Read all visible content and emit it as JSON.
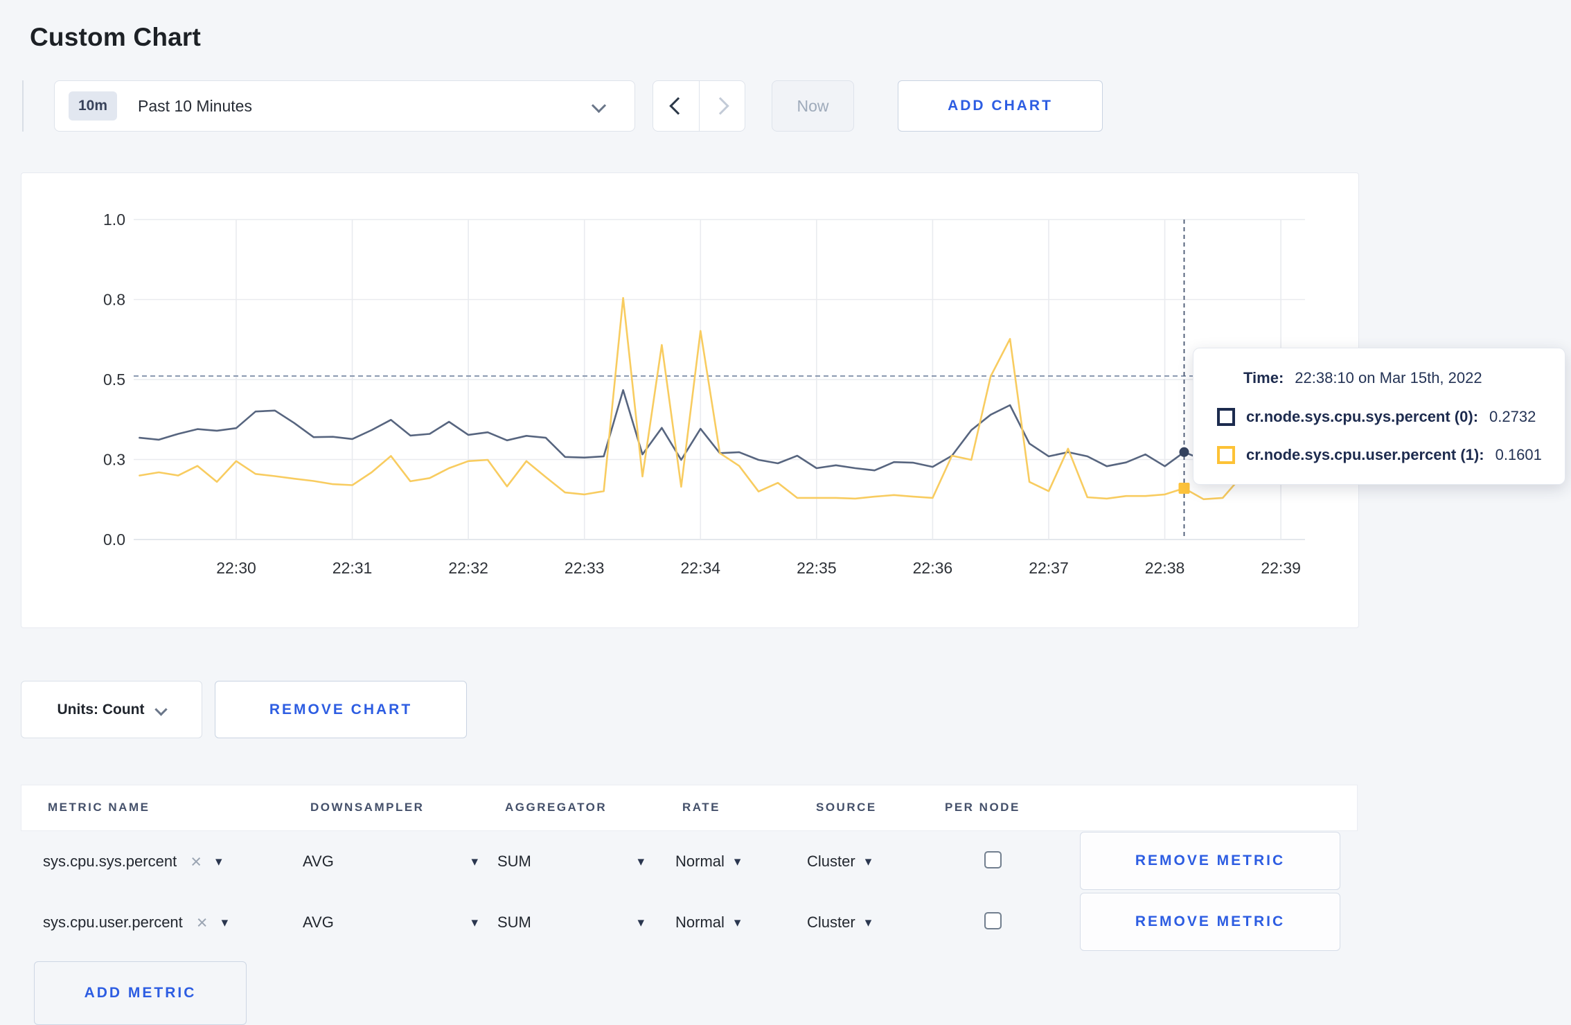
{
  "page": {
    "title": "Custom Chart",
    "accent_blue": "#2d5de2",
    "background": "#f4f6f9"
  },
  "toolbar": {
    "time_badge": "10m",
    "time_label": "Past 10 Minutes",
    "now_label": "Now",
    "add_chart_label": "ADD CHART"
  },
  "chart_controls": {
    "units_label": "Units: Count",
    "remove_chart_label": "REMOVE CHART"
  },
  "tooltip": {
    "time_label": "Time:",
    "time_value": "22:38:10 on Mar 15th, 2022",
    "series": [
      {
        "label": "cr.node.sys.cpu.sys.percent (0):",
        "value": "0.2732",
        "swatch_color": "#1c2b4e"
      },
      {
        "label": "cr.node.sys.cpu.user.percent (1):",
        "value": "0.1601",
        "swatch_color": "#fdc236"
      }
    ]
  },
  "metrics_table": {
    "columns": [
      "METRIC NAME",
      "DOWNSAMPLER",
      "AGGREGATOR",
      "RATE",
      "SOURCE",
      "PER NODE"
    ],
    "rows": [
      {
        "metric_name": "sys.cpu.sys.percent",
        "downsampler": "AVG",
        "aggregator": "SUM",
        "rate": "Normal",
        "source": "Cluster",
        "per_node_checked": false,
        "remove_label": "REMOVE METRIC"
      },
      {
        "metric_name": "sys.cpu.user.percent",
        "downsampler": "AVG",
        "aggregator": "SUM",
        "rate": "Normal",
        "source": "Cluster",
        "per_node_checked": false,
        "remove_label": "REMOVE METRIC"
      }
    ],
    "add_metric_label": "ADD METRIC"
  },
  "chart_data": {
    "type": "line",
    "title": "",
    "xlabel": "",
    "ylabel": "",
    "ylim": [
      0,
      1
    ],
    "grid": true,
    "x_ticks": [
      "22:30",
      "22:31",
      "22:32",
      "22:33",
      "22:34",
      "22:35",
      "22:36",
      "22:37",
      "22:38",
      "22:39"
    ],
    "y_ticks": [
      {
        "value": 0.0,
        "label": "0.0"
      },
      {
        "value": 0.25,
        "label": "0.3"
      },
      {
        "value": 0.5,
        "label": "0.5"
      },
      {
        "value": 0.75,
        "label": "0.8"
      },
      {
        "value": 1.0,
        "label": "1.0"
      }
    ],
    "x_start_offset_seconds": -50,
    "x_interval_seconds": 10,
    "guide_line_value": 0.511,
    "hover": {
      "offset_seconds": 490,
      "time": "22:38:10"
    },
    "series": [
      {
        "name": "cr.node.sys.cpu.sys.percent (0)",
        "color": "#57657f",
        "marker": "circle",
        "marker_color": "#35435f",
        "hover_value": 0.2732,
        "values": [
          0.318,
          0.312,
          0.33,
          0.345,
          0.34,
          0.348,
          0.4,
          0.403,
          0.364,
          0.32,
          0.321,
          0.314,
          0.342,
          0.374,
          0.325,
          0.33,
          0.368,
          0.327,
          0.335,
          0.31,
          0.324,
          0.318,
          0.258,
          0.256,
          0.26,
          0.467,
          0.266,
          0.349,
          0.249,
          0.346,
          0.27,
          0.273,
          0.249,
          0.238,
          0.262,
          0.223,
          0.232,
          0.223,
          0.216,
          0.242,
          0.24,
          0.227,
          0.262,
          0.342,
          0.39,
          0.42,
          0.3,
          0.26,
          0.273,
          0.26,
          0.229,
          0.241,
          0.266,
          0.229,
          0.2732,
          0.249,
          0.262,
          0.28,
          0.297,
          0.3,
          0.305
        ]
      },
      {
        "name": "cr.node.sys.cpu.user.percent (1)",
        "color": "#f8cc60",
        "marker": "square",
        "marker_color": "#fdc33c",
        "hover_value": 0.1601,
        "values": [
          0.2,
          0.21,
          0.2,
          0.23,
          0.18,
          0.245,
          0.205,
          0.198,
          0.19,
          0.183,
          0.173,
          0.17,
          0.21,
          0.261,
          0.182,
          0.192,
          0.223,
          0.245,
          0.249,
          0.166,
          0.245,
          0.195,
          0.147,
          0.141,
          0.151,
          0.755,
          0.197,
          0.608,
          0.165,
          0.652,
          0.27,
          0.23,
          0.15,
          0.177,
          0.13,
          0.13,
          0.13,
          0.128,
          0.134,
          0.139,
          0.134,
          0.13,
          0.262,
          0.249,
          0.51,
          0.627,
          0.18,
          0.151,
          0.284,
          0.132,
          0.128,
          0.136,
          0.136,
          0.141,
          0.1601,
          0.126,
          0.13,
          0.2,
          0.21,
          0.175,
          0.27
        ]
      }
    ]
  }
}
